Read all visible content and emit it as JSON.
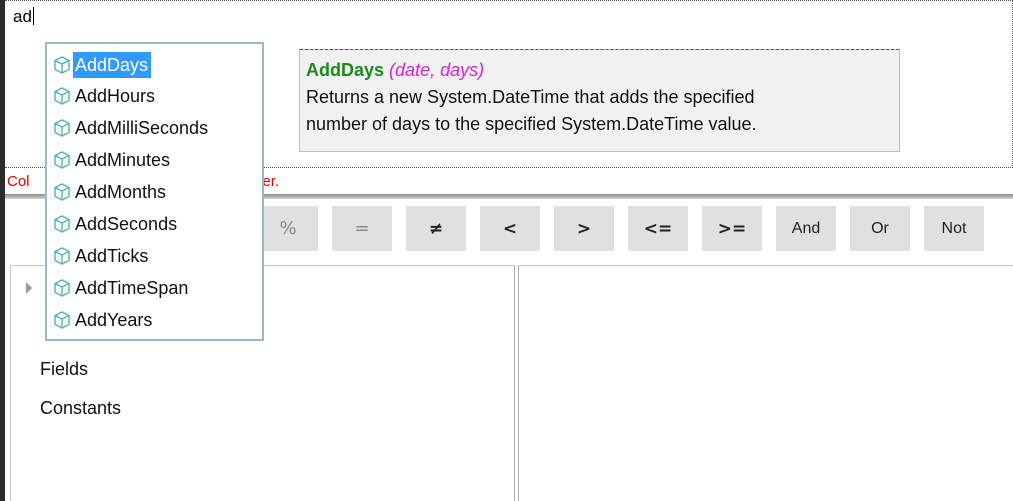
{
  "editor": {
    "text": "ad"
  },
  "status": {
    "message": "Column or parameter name is not a valid identifier.",
    "visible_start": "Col",
    "visible_end": "ifier."
  },
  "toolbar": {
    "buttons": [
      {
        "label": "%"
      },
      {
        "label": "="
      },
      {
        "label": "≠"
      },
      {
        "label": "<"
      },
      {
        "label": ">"
      },
      {
        "label": "<="
      },
      {
        "label": ">="
      },
      {
        "label": "And"
      },
      {
        "label": "Or"
      },
      {
        "label": "Not"
      }
    ]
  },
  "tree": {
    "items": [
      {
        "label": "Fields"
      },
      {
        "label": "Constants"
      }
    ]
  },
  "autocomplete": {
    "icon": "function-cube-icon",
    "selected_index": 0,
    "items": [
      {
        "label": "AddDays"
      },
      {
        "label": "AddHours"
      },
      {
        "label": "AddMilliSeconds"
      },
      {
        "label": "AddMinutes"
      },
      {
        "label": "AddMonths"
      },
      {
        "label": "AddSeconds"
      },
      {
        "label": "AddTicks"
      },
      {
        "label": "AddTimeSpan"
      },
      {
        "label": "AddYears"
      }
    ]
  },
  "tooltip": {
    "name": "AddDays",
    "params": "(date, days)",
    "line1": "Returns a new System.DateTime that adds the specified",
    "line2": "number of days to the specified System.DateTime value."
  },
  "colors": {
    "selection": "#3399ff",
    "error": "#e00000",
    "function_name": "#1c8a1c",
    "params": "#d822d8",
    "cube": "#4fb3b3"
  }
}
